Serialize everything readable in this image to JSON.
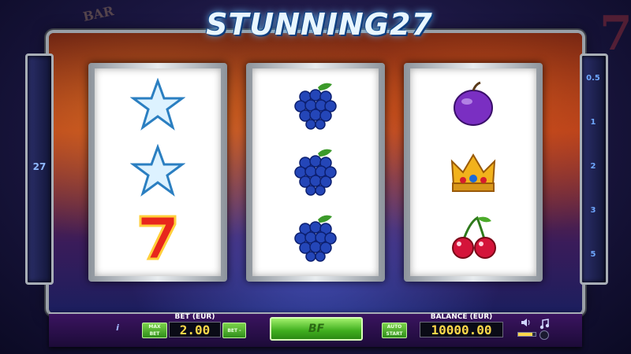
{
  "game": {
    "title": "STUNNING27",
    "lines_count": "27",
    "paylines": [
      "0.5",
      "1",
      "2",
      "3",
      "5"
    ]
  },
  "reels": [
    {
      "symbols": [
        "star",
        "star",
        "seven"
      ]
    },
    {
      "symbols": [
        "grapes",
        "grapes",
        "grapes"
      ]
    },
    {
      "symbols": [
        "plum",
        "crown",
        "cherries"
      ]
    }
  ],
  "background": {
    "bar_sign": "BAR",
    "seven_sign": "7"
  },
  "controls": {
    "info_label": "i",
    "bet_label": "BET (EUR)",
    "bet_value": "2.00",
    "max_bet_label": "MAX BET",
    "bet_minus_label": "BET -",
    "auto_start_label": "AUTO START",
    "balance_label": "BALANCE (EUR)",
    "balance_value": "10000.00",
    "spin_label": "BF"
  },
  "colors": {
    "accent": "#3fae1e",
    "digits": "#ffd84a",
    "payline_text": "#6fa8ff"
  }
}
